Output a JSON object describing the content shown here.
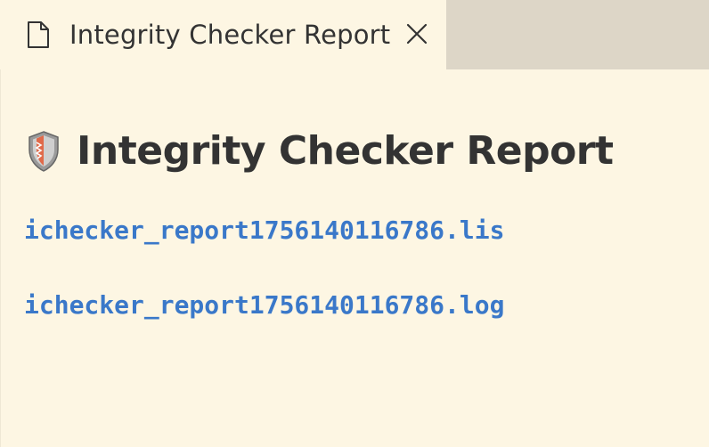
{
  "tab": {
    "title": "Integrity Checker Report",
    "icon": "file-icon",
    "close_icon": "close-icon"
  },
  "report": {
    "title": "Integrity Checker Report",
    "icon": "shield-icon",
    "files": [
      "ichecker_report1756140116786.lis",
      "ichecker_report1756140116786.log"
    ]
  },
  "colors": {
    "background": "#fdf6e3",
    "tabbar": "#ddd6c7",
    "link": "#3a78c9",
    "text": "#333333"
  }
}
